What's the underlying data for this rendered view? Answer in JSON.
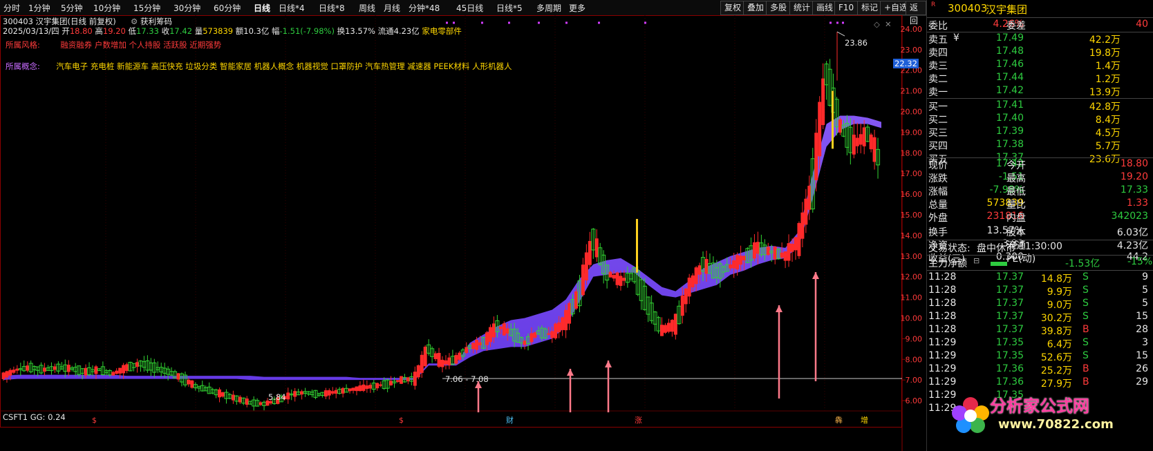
{
  "toolbar": {
    "periods": [
      "分时",
      "1分钟",
      "5分钟",
      "10分钟",
      "15分钟",
      "30分钟",
      "60分钟",
      "日线",
      "日线*4",
      "日线*8",
      "周线",
      "月线",
      "分钟*48",
      "45日线",
      "日线*5",
      "多周期",
      "更多"
    ],
    "active": "日线",
    "right_buttons": [
      "复权",
      "叠加",
      "多股",
      "统计",
      "画线",
      "F10",
      "标记",
      "+自选",
      "返回"
    ]
  },
  "chart": {
    "title": "300403 汉宇集团(日线 前复权)",
    "indicator": "获利筹码",
    "ohlc_line": {
      "date": "2025/03/13/四",
      "open_label": "开",
      "open": "18.80",
      "high_label": "高",
      "high": "19.20",
      "low_label": "低",
      "low": "17.33",
      "close_label": "收",
      "close": "17.42",
      "vol_label": "量",
      "vol": "573839",
      "amt_label": "额",
      "amt": "10.3亿",
      "chg_label": "幅",
      "chg": "-1.51(-7.98%)",
      "turn_label": "换",
      "turn": "13.57%",
      "float_label": "流通",
      "float": "4.23亿",
      "industry": "家电零部件"
    },
    "style_label": "所属风格:",
    "style_text": "融资融券 户数增加 个人持股 活跃股 近期强势",
    "concept_label": "所属概念:",
    "concept_text": "汽车电子 充电桩 新能源车 高压快充 垃圾分类 智能家居 机器人概念 机器视觉 口罩防护 汽车热管理 减速器 PEEK材料 人形机器人",
    "high_mark": "23.86",
    "low_mark": "5.84",
    "range_mark": "7.06 - 7.08",
    "cur_price_tag": "22.32",
    "bottom_indicator": "CSFT1 GG: 0.24",
    "bottom_marks": [
      "$",
      "$",
      "财",
      "涨",
      "犇",
      "增"
    ]
  },
  "chart_data": {
    "type": "candlestick",
    "ylim": [
      5.5,
      24.6
    ],
    "y_ticks": [
      "24.00",
      "23.00",
      "22.00",
      "21.00",
      "20.00",
      "19.00",
      "18.00",
      "17.00",
      "16.00",
      "15.00",
      "14.00",
      "13.00",
      "12.00",
      "11.00",
      "10.00",
      "9.00",
      "8.00",
      "7.00",
      "6.00"
    ],
    "y_tick_values": [
      24,
      23,
      22,
      21,
      20,
      19,
      18,
      17,
      16,
      15,
      14,
      13,
      12,
      11,
      10,
      9,
      8,
      7,
      6
    ],
    "reference_line": 7.07,
    "trend": [
      7.2,
      7.5,
      7.6,
      7.5,
      7.6,
      7.55,
      7.4,
      7.5,
      7.3,
      7.6,
      7.8,
      7.6,
      7.4,
      7.1,
      6.7,
      6.5,
      6.3,
      6.1,
      5.9,
      5.84,
      6.0,
      6.3,
      6.4,
      6.3,
      6.4,
      6.5,
      6.6,
      6.7,
      6.8,
      7.0,
      7.06,
      8.5,
      7.8,
      8.0,
      8.6,
      8.8,
      9.6,
      9.3,
      8.8,
      9.3,
      9.2,
      9.9,
      11.2,
      13.8,
      12.2,
      11.8,
      12.1,
      10.6,
      9.4,
      9.7,
      11.5,
      12.6,
      12.2,
      12.5,
      12.9,
      13.4,
      13.2,
      13.0,
      13.8,
      16.5,
      21.8,
      19.3,
      18.4,
      18.9,
      17.42
    ],
    "band_bottom": [
      7.0,
      7.05,
      7.05,
      7.05,
      7.05,
      7.05,
      7.05,
      7.05,
      7.05,
      7.05,
      7.05,
      7.05,
      7.05,
      7.05,
      7.05,
      7.05,
      7.05,
      7.05,
      7.0,
      7.0,
      7.0,
      7.0,
      7.0,
      7.0,
      7.0,
      7.0,
      7.0,
      7.0,
      7.0,
      7.0,
      7.0,
      7.7,
      7.7,
      7.7,
      8.1,
      8.4,
      8.5,
      8.6,
      8.6,
      8.8,
      9.0,
      9.6,
      10.8,
      12.0,
      12.1,
      12.2,
      12.2,
      11.6,
      11.1,
      11.0,
      11.2,
      11.4,
      11.6,
      12.1,
      12.3,
      12.6,
      12.8,
      12.9,
      13.5,
      15.8,
      18.3,
      19.1,
      19.4,
      19.4,
      19.2
    ],
    "band_top": [
      7.2,
      7.25,
      7.25,
      7.25,
      7.25,
      7.25,
      7.25,
      7.25,
      7.25,
      7.2,
      7.2,
      7.2,
      7.2,
      7.2,
      7.2,
      7.2,
      7.2,
      7.2,
      7.2,
      7.15,
      7.15,
      7.15,
      7.15,
      7.15,
      7.15,
      7.15,
      7.1,
      7.1,
      7.1,
      7.1,
      7.1,
      7.8,
      7.8,
      7.8,
      8.8,
      9.2,
      9.6,
      9.9,
      10.0,
      10.2,
      10.4,
      10.9,
      11.9,
      12.6,
      12.8,
      12.9,
      12.5,
      12.0,
      11.5,
      11.3,
      11.8,
      12.4,
      12.7,
      13.0,
      13.2,
      13.4,
      13.5,
      13.4,
      14.2,
      17.0,
      19.4,
      19.8,
      19.8,
      19.7,
      19.5
    ]
  },
  "panel": {
    "code": "300403",
    "name": "汉宇集团",
    "weibi_label": "委比",
    "weibi": "4.26%",
    "weicha_label": "委差",
    "weicha": "40",
    "sell": [
      {
        "label": "卖五",
        "extra": "¥",
        "price": "17.49",
        "vol": "42.2万"
      },
      {
        "label": "卖四",
        "extra": "",
        "price": "17.48",
        "vol": "19.8万"
      },
      {
        "label": "卖三",
        "extra": "",
        "price": "17.46",
        "vol": "1.4万"
      },
      {
        "label": "卖二",
        "extra": "",
        "price": "17.44",
        "vol": "1.2万"
      },
      {
        "label": "卖一",
        "extra": "",
        "price": "17.42",
        "vol": "13.9万"
      }
    ],
    "buy": [
      {
        "label": "买一",
        "price": "17.41",
        "vol": "42.8万"
      },
      {
        "label": "买二",
        "price": "17.40",
        "vol": "8.4万"
      },
      {
        "label": "买三",
        "price": "17.39",
        "vol": "4.5万"
      },
      {
        "label": "买四",
        "price": "17.38",
        "vol": "5.7万"
      },
      {
        "label": "买五",
        "price": "17.37",
        "vol": "23.6万"
      }
    ],
    "quote": [
      {
        "l1": "现价",
        "v1": "17.42",
        "c1": "#2ecc40",
        "l2": "今开",
        "v2": "18.80",
        "c2": "#ff3b3b"
      },
      {
        "l1": "涨跌",
        "v1": "-1.51",
        "c1": "#2ecc40",
        "l2": "最高",
        "v2": "19.20",
        "c2": "#ff3b3b"
      },
      {
        "l1": "涨幅",
        "v1": "-7.98%",
        "c1": "#2ecc40",
        "l2": "最低",
        "v2": "17.33",
        "c2": "#2ecc40"
      },
      {
        "l1": "总量",
        "v1": "573839",
        "c1": "#ffd700",
        "l2": "量比",
        "v2": "1.33",
        "c2": "#ff3b3b"
      },
      {
        "l1": "外盘",
        "v1": "231816",
        "c1": "#ff3b3b",
        "l2": "内盘",
        "v2": "342023",
        "c2": "#2ecc40"
      }
    ],
    "fund": [
      {
        "l1": "换手",
        "v1": "13.57%",
        "l2": "股本",
        "v2": "6.03亿"
      },
      {
        "l1": "净资",
        "v1": "3.33",
        "l2": "流通",
        "v2": "4.23亿"
      },
      {
        "l1": "收益(三)",
        "v1": "0.300",
        "l2": "PE(动)",
        "v2": "44.2"
      }
    ],
    "status_label": "交易状态:",
    "status": "盘中休市",
    "status_time": "11:30:00",
    "mainflow_label": "主力净额",
    "mainflow": "-1.53亿",
    "mainflow_pct": "-15%",
    "ticks": [
      {
        "t": "11:28",
        "p": "17.37",
        "v": "14.8万",
        "d": "S",
        "n": "9"
      },
      {
        "t": "11:28",
        "p": "17.37",
        "v": "9.9万",
        "d": "S",
        "n": "5"
      },
      {
        "t": "11:28",
        "p": "17.37",
        "v": "9.0万",
        "d": "S",
        "n": "5"
      },
      {
        "t": "11:28",
        "p": "17.37",
        "v": "30.2万",
        "d": "S",
        "n": "15"
      },
      {
        "t": "11:28",
        "p": "17.37",
        "v": "39.8万",
        "d": "B",
        "n": "28"
      },
      {
        "t": "11:29",
        "p": "17.35",
        "v": "6.4万",
        "d": "S",
        "n": "3"
      },
      {
        "t": "11:29",
        "p": "17.35",
        "v": "52.6万",
        "d": "S",
        "n": "15"
      },
      {
        "t": "11:29",
        "p": "17.36",
        "v": "25.2万",
        "d": "B",
        "n": "26"
      },
      {
        "t": "11:29",
        "p": "17.36",
        "v": "27.9万",
        "d": "B",
        "n": "29"
      },
      {
        "t": "11:29",
        "p": "17.35",
        "v": "",
        "d": "",
        "n": ""
      },
      {
        "t": "11:29",
        "p": "",
        "v": "",
        "d": "",
        "n": ""
      }
    ]
  },
  "watermark": {
    "cn": "分析家公式网",
    "url": "www.70822.com"
  }
}
